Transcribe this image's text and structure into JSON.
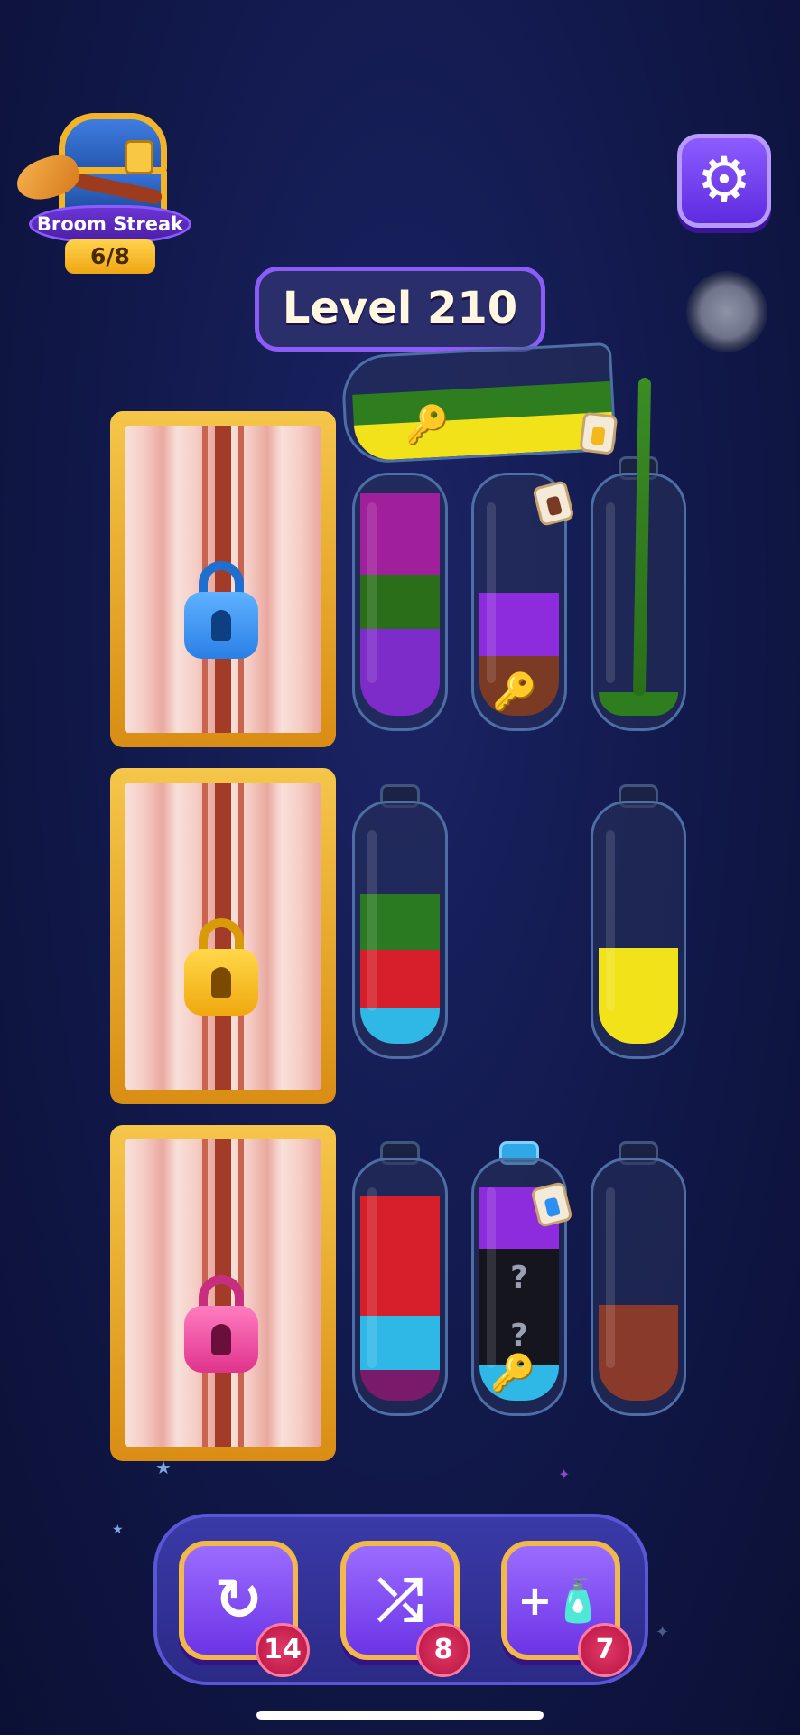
{
  "streak": {
    "label": "Broom Streak",
    "progress": "6/8"
  },
  "settings": {
    "icon": "gear-icon",
    "glyph": "⚙"
  },
  "level": {
    "title": "Level 210"
  },
  "locks": [
    {
      "color": "#2f8ff0",
      "name": "blue"
    },
    {
      "color": "#f3b91c",
      "name": "yellow"
    },
    {
      "color": "#e24c9a",
      "name": "pink"
    }
  ],
  "tubes": [
    {
      "id": "r1-t1",
      "layers": [
        "#a01f9a",
        "#2a6e1a",
        "#7d2bc9"
      ]
    },
    {
      "id": "r1-t2",
      "layers": [
        "#8c2cdc",
        "#7a3a24"
      ],
      "key": "yellow-key",
      "tag": "brown"
    },
    {
      "id": "r1-t3",
      "layers": [
        "#2e7d1e"
      ]
    },
    {
      "id": "r2-t1",
      "layers": [
        "#2a7a22",
        "#d61f2a",
        "#2fb8e6"
      ]
    },
    {
      "id": "r2-t3",
      "layers": [
        "#f2e21a"
      ]
    },
    {
      "id": "r3-t1",
      "layers": [
        "#d61f2a",
        "#2fb8e6",
        "#7a1a6a"
      ]
    },
    {
      "id": "r3-t2",
      "layers": [
        "#8c2cdc",
        "?",
        "?",
        "#2fb8e6"
      ],
      "key": "pink-key",
      "tag": "blue"
    },
    {
      "id": "r3-t3",
      "layers": [
        "#8a3a2a"
      ]
    }
  ],
  "pouring": {
    "layers": [
      "#2e7d1e",
      "#f2e21a"
    ],
    "key": "blue-key"
  },
  "powerups": [
    {
      "name": "undo",
      "glyph": "↻",
      "count": "14"
    },
    {
      "name": "shuffle",
      "glyph": "⤮",
      "count": "8"
    },
    {
      "name": "add-tube",
      "glyph": "+🧴",
      "count": "7"
    }
  ],
  "qmark": "?"
}
